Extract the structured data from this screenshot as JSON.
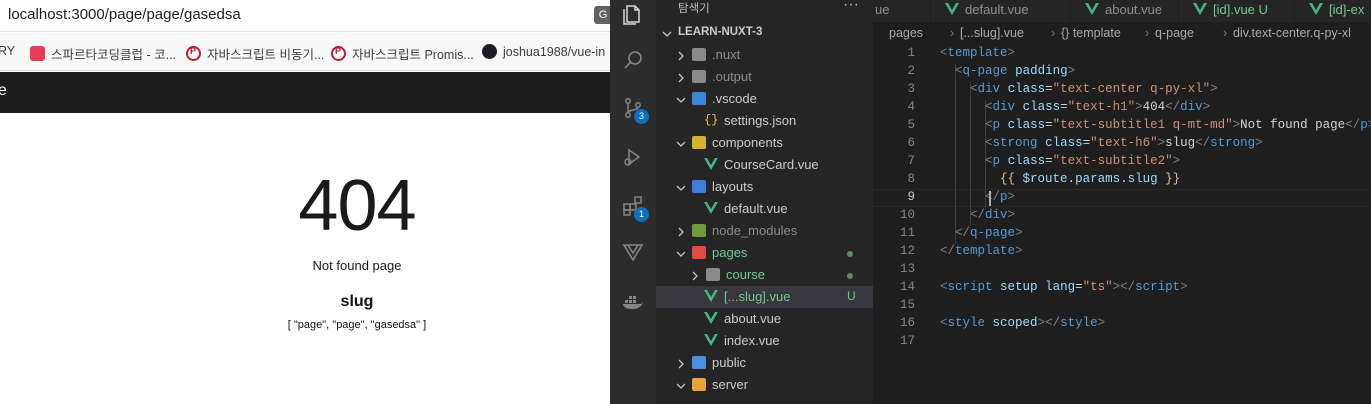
{
  "browser": {
    "url": "localhost:3000/page/page/gasedsa",
    "bookmarks": [
      {
        "label": "RY",
        "icon": "none"
      },
      {
        "label": "스파르타코딩클럽 - 코...",
        "icon": "heart-favicon"
      },
      {
        "label": "자바스크립트 비동기...",
        "icon": "p-favicon"
      },
      {
        "label": "자바스크립트 Promis...",
        "icon": "p-favicon"
      },
      {
        "label": "joshua1988/vue-in",
        "icon": "github-favicon"
      }
    ],
    "tab_text": "e",
    "page": {
      "code": "404",
      "title": "Not found page",
      "strong": "slug",
      "params": "[ \"page\", \"page\", \"gasedsa\" ]"
    }
  },
  "vscode": {
    "explorer_title": "탐색기",
    "explorer_more": "···",
    "activity": [
      {
        "name": "files-icon"
      },
      {
        "name": "search-icon"
      },
      {
        "name": "source-control-icon",
        "badge": "3"
      },
      {
        "name": "run-debug-icon"
      },
      {
        "name": "extensions-icon",
        "badge": "1"
      },
      {
        "name": "vue-devtools-icon"
      },
      {
        "name": "docker-icon"
      }
    ],
    "tree": [
      {
        "label": "LEARN-NUXT-3",
        "kind": "root"
      },
      {
        "label": ".nuxt",
        "kind": "folder",
        "depth": 1,
        "dim": true
      },
      {
        "label": ".output",
        "kind": "folder",
        "depth": 1,
        "dim": true
      },
      {
        "label": ".vscode",
        "kind": "folder-open",
        "depth": 1,
        "icon": "vscode"
      },
      {
        "label": "settings.json",
        "kind": "json",
        "depth": 2
      },
      {
        "label": "components",
        "kind": "folder-open",
        "depth": 1,
        "icon": "comp"
      },
      {
        "label": "CourseCard.vue",
        "kind": "vue",
        "depth": 2
      },
      {
        "label": "layouts",
        "kind": "folder-open",
        "depth": 1,
        "icon": "layouts"
      },
      {
        "label": "default.vue",
        "kind": "vue",
        "depth": 2
      },
      {
        "label": "node_modules",
        "kind": "folder",
        "depth": 1,
        "icon": "node",
        "dim": true
      },
      {
        "label": "pages",
        "kind": "folder-open",
        "depth": 1,
        "icon": "pages",
        "green": true,
        "dot": true
      },
      {
        "label": "course",
        "kind": "folder",
        "depth": 2,
        "green": true,
        "dot": true
      },
      {
        "label": "[...slug].vue",
        "kind": "vue",
        "depth": 2,
        "green": true,
        "badge": "U",
        "selected": true
      },
      {
        "label": "about.vue",
        "kind": "vue",
        "depth": 2
      },
      {
        "label": "index.vue",
        "kind": "vue",
        "depth": 2
      },
      {
        "label": "public",
        "kind": "folder",
        "depth": 1,
        "icon": "public"
      },
      {
        "label": "server",
        "kind": "folder-open",
        "depth": 1,
        "icon": "server"
      }
    ],
    "tabs": [
      {
        "label": "ue",
        "green": false
      },
      {
        "label": "default.vue",
        "green": false
      },
      {
        "label": "about.vue",
        "green": false
      },
      {
        "label": "[id].vue U",
        "green": true
      },
      {
        "label": "[id]-ex",
        "green": true
      }
    ],
    "breadcrumb": [
      "pages",
      "[...slug].vue",
      "{} template",
      "q-page",
      "div.text-center.q-py-xl"
    ],
    "code_lines": [
      [
        [
          "brk",
          "<"
        ],
        [
          "tag",
          "template"
        ],
        [
          "brk",
          ">"
        ]
      ],
      [
        [
          "txt",
          "  "
        ],
        [
          "brk",
          "<"
        ],
        [
          "tag",
          "q-page"
        ],
        [
          "txt",
          " "
        ],
        [
          "attr",
          "padding"
        ],
        [
          "brk",
          ">"
        ]
      ],
      [
        [
          "txt",
          "    "
        ],
        [
          "brk",
          "<"
        ],
        [
          "tag",
          "div"
        ],
        [
          "txt",
          " "
        ],
        [
          "attr",
          "class"
        ],
        [
          "txt",
          "="
        ],
        [
          "str",
          "\"text-center q-py-xl\""
        ],
        [
          "brk",
          ">"
        ]
      ],
      [
        [
          "txt",
          "      "
        ],
        [
          "brk",
          "<"
        ],
        [
          "tag",
          "div"
        ],
        [
          "txt",
          " "
        ],
        [
          "attr",
          "class"
        ],
        [
          "txt",
          "="
        ],
        [
          "str",
          "\"text-h1\""
        ],
        [
          "brk",
          ">"
        ],
        [
          "txt",
          "404"
        ],
        [
          "brk",
          "</"
        ],
        [
          "tag",
          "div"
        ],
        [
          "brk",
          ">"
        ]
      ],
      [
        [
          "txt",
          "      "
        ],
        [
          "brk",
          "<"
        ],
        [
          "tag",
          "p"
        ],
        [
          "txt",
          " "
        ],
        [
          "attr",
          "class"
        ],
        [
          "txt",
          "="
        ],
        [
          "str",
          "\"text-subtitle1 q-mt-md\""
        ],
        [
          "brk",
          ">"
        ],
        [
          "txt",
          "Not found page"
        ],
        [
          "brk",
          "</"
        ],
        [
          "tag",
          "p"
        ],
        [
          "brk",
          ">"
        ]
      ],
      [
        [
          "txt",
          "      "
        ],
        [
          "brk",
          "<"
        ],
        [
          "tag",
          "strong"
        ],
        [
          "txt",
          " "
        ],
        [
          "attr",
          "class"
        ],
        [
          "txt",
          "="
        ],
        [
          "str",
          "\"text-h6\""
        ],
        [
          "brk",
          ">"
        ],
        [
          "txt",
          "slug"
        ],
        [
          "brk",
          "</"
        ],
        [
          "tag",
          "strong"
        ],
        [
          "brk",
          ">"
        ]
      ],
      [
        [
          "txt",
          "      "
        ],
        [
          "brk",
          "<"
        ],
        [
          "tag",
          "p"
        ],
        [
          "txt",
          " "
        ],
        [
          "attr",
          "class"
        ],
        [
          "txt",
          "="
        ],
        [
          "str",
          "\"text-subtitle2\""
        ],
        [
          "brk",
          ">"
        ]
      ],
      [
        [
          "txt",
          "        "
        ],
        [
          "mus",
          "{{ "
        ],
        [
          "var",
          "$route"
        ],
        [
          "txt",
          "."
        ],
        [
          "var",
          "params"
        ],
        [
          "txt",
          "."
        ],
        [
          "var",
          "slug"
        ],
        [
          "mus",
          " }}"
        ]
      ],
      [
        [
          "txt",
          "      "
        ],
        [
          "brk",
          "</"
        ],
        [
          "tag",
          "p"
        ],
        [
          "brk",
          ">"
        ]
      ],
      [
        [
          "txt",
          "    "
        ],
        [
          "brk",
          "</"
        ],
        [
          "tag",
          "div"
        ],
        [
          "brk",
          ">"
        ]
      ],
      [
        [
          "txt",
          "  "
        ],
        [
          "brk",
          "</"
        ],
        [
          "tag",
          "q-page"
        ],
        [
          "brk",
          ">"
        ]
      ],
      [
        [
          "brk",
          "</"
        ],
        [
          "tag",
          "template"
        ],
        [
          "brk",
          ">"
        ]
      ],
      [],
      [
        [
          "brk",
          "<"
        ],
        [
          "tag",
          "script"
        ],
        [
          "txt",
          " "
        ],
        [
          "attr",
          "setup"
        ],
        [
          "txt",
          " "
        ],
        [
          "attr",
          "lang"
        ],
        [
          "txt",
          "="
        ],
        [
          "str",
          "\"ts\""
        ],
        [
          "brk",
          "></"
        ],
        [
          "tag",
          "script"
        ],
        [
          "brk",
          ">"
        ]
      ],
      [],
      [
        [
          "brk",
          "<"
        ],
        [
          "tag",
          "style"
        ],
        [
          "txt",
          " "
        ],
        [
          "attr",
          "scoped"
        ],
        [
          "brk",
          "></"
        ],
        [
          "tag",
          "style"
        ],
        [
          "brk",
          ">"
        ]
      ],
      []
    ],
    "current_line": 9,
    "colors": {
      "editor_bg": "#1e1e1e",
      "sidebar_bg": "#252526",
      "activity_bg": "#2c2c2c",
      "git_untracked": "#73c991",
      "badge_blue": "#0e70c0"
    }
  }
}
